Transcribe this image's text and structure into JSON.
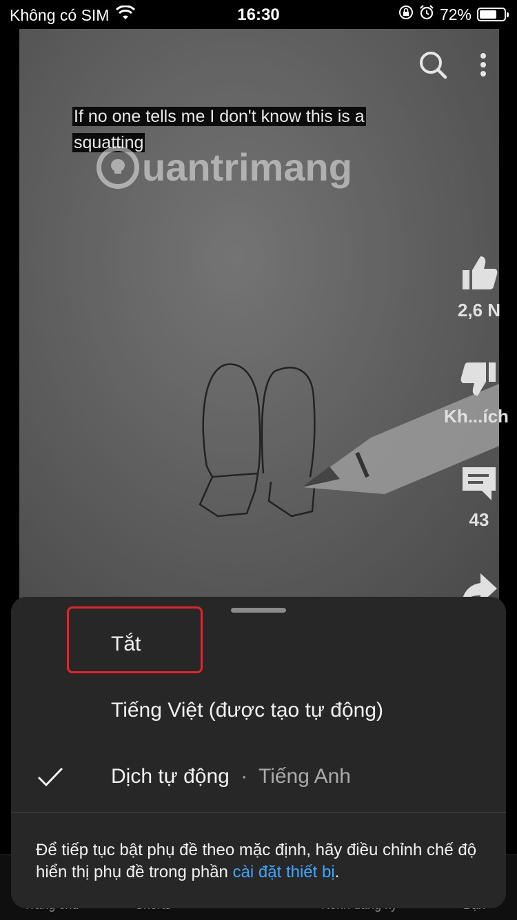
{
  "status_bar": {
    "carrier": "Không có SIM",
    "time": "16:30",
    "battery_percent": "72%",
    "battery_level": 0.72
  },
  "video": {
    "caption": "If no one tells me I don't know this is a squatting",
    "watermark": "uantrimang"
  },
  "rail": {
    "like_count": "2,6 N",
    "dislike_label": "Kh...ích",
    "comment_count": "43"
  },
  "bottom_nav": {
    "items": [
      "Trang chủ",
      "Shorts",
      "Kênh đăng ký",
      "Bạn"
    ]
  },
  "sheet": {
    "options": [
      {
        "label": "Tắt"
      },
      {
        "label": "Tiếng Việt (được tạo tự động)"
      },
      {
        "label": "Dịch tự động",
        "sublabel": "Tiếng Anh",
        "selected": true
      }
    ],
    "separator": "·",
    "note_text": "Để tiếp tục bật phụ đề theo mặc định, hãy điều chỉnh chế độ hiển thị phụ đề trong phần ",
    "note_link": "cài đặt thiết bị",
    "note_end": "."
  },
  "colors": {
    "sheet_bg": "#272727",
    "highlight": "#e3242b",
    "link": "#3ea6ff"
  }
}
